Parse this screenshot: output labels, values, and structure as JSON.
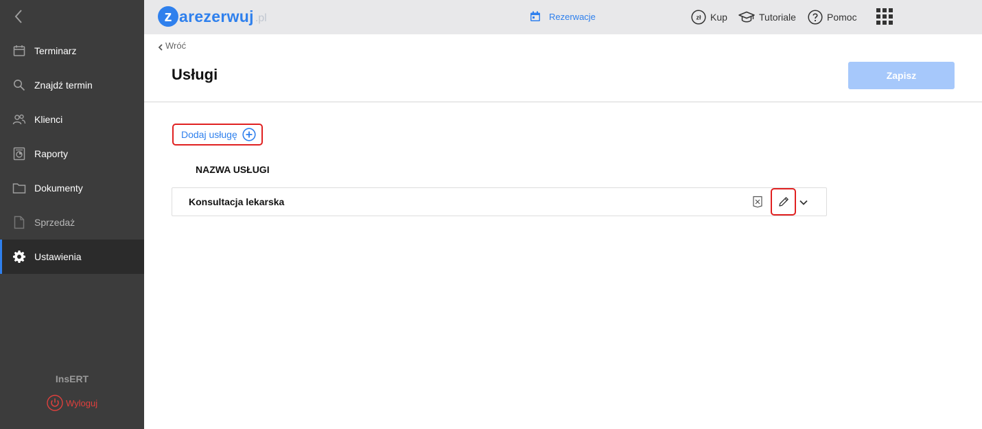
{
  "sidebar": {
    "items": [
      {
        "label": "Terminarz",
        "icon": "calendar-icon"
      },
      {
        "label": "Znajdź termin",
        "icon": "search-icon"
      },
      {
        "label": "Klienci",
        "icon": "users-icon"
      },
      {
        "label": "Raporty",
        "icon": "report-icon"
      },
      {
        "label": "Dokumenty",
        "icon": "folder-icon"
      },
      {
        "label": "Sprzedaż",
        "icon": "document-icon"
      },
      {
        "label": "Ustawienia",
        "icon": "gear-icon"
      }
    ],
    "active_item": "Ustawienia",
    "brand": "InsERT",
    "logout_label": "Wyloguj"
  },
  "topbar": {
    "logo_letter": "z",
    "logo_word": "arezerwuj",
    "logo_suffix": ".pl",
    "reservations_label": "Rezerwacje",
    "buy_label": "Kup",
    "buy_badge": "zł",
    "tutorials_label": "Tutoriale",
    "help_label": "Pomoc"
  },
  "main": {
    "back_label": "Wróć",
    "title": "Usługi",
    "save_label": "Zapisz",
    "add_service_label": "Dodaj usługę",
    "column_header": "NAZWA USŁUGI",
    "services": [
      {
        "name": "Konsultacja lekarska"
      }
    ]
  },
  "colors": {
    "accent": "#2f80ed",
    "sidebar_bg": "#3c3c3c",
    "topbar_bg": "#e8e8ea",
    "highlight": "#e02020",
    "save_disabled": "#a6c8fb",
    "logout": "#e0403d"
  }
}
